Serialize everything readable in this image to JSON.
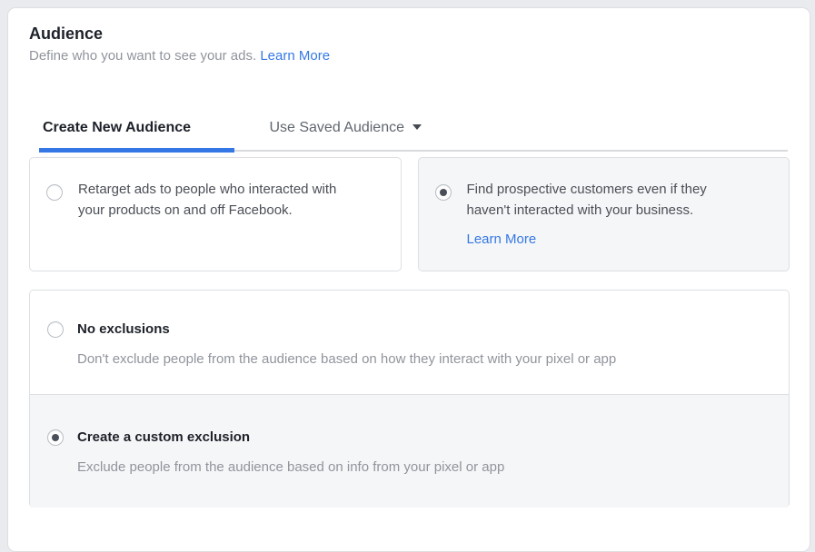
{
  "header": {
    "title": "Audience",
    "subtitle": "Define who you want to see your ads.",
    "learn_more_label": "Learn More"
  },
  "tabs": [
    {
      "label": "Create New Audience",
      "active": true
    },
    {
      "label": "Use Saved Audience",
      "active": false,
      "caret_icon": "caret-down"
    }
  ],
  "targeting_options": [
    {
      "label": "Retarget ads to people who interacted with your products on and off Facebook.",
      "selected": false
    },
    {
      "label": "Find prospective customers even if they haven't interacted with your business.",
      "learn_more_label": "Learn More",
      "selected": true
    }
  ],
  "exclusion_options": [
    {
      "title": "No exclusions",
      "description": "Don't exclude people from the audience based on how they interact with your pixel or app",
      "selected": false
    },
    {
      "title": "Create a custom exclusion",
      "description": "Exclude people from the audience based on info from your pixel or app",
      "selected": true
    }
  ],
  "colors": {
    "accent": "#3578e5",
    "page-bg": "#e9ebee",
    "border": "#dddfe2",
    "fill-gray": "#f5f6f7",
    "text-dark": "#1d2129",
    "text-body": "#4b4f56",
    "text-gray": "#616770",
    "text-muted": "#90949c"
  }
}
